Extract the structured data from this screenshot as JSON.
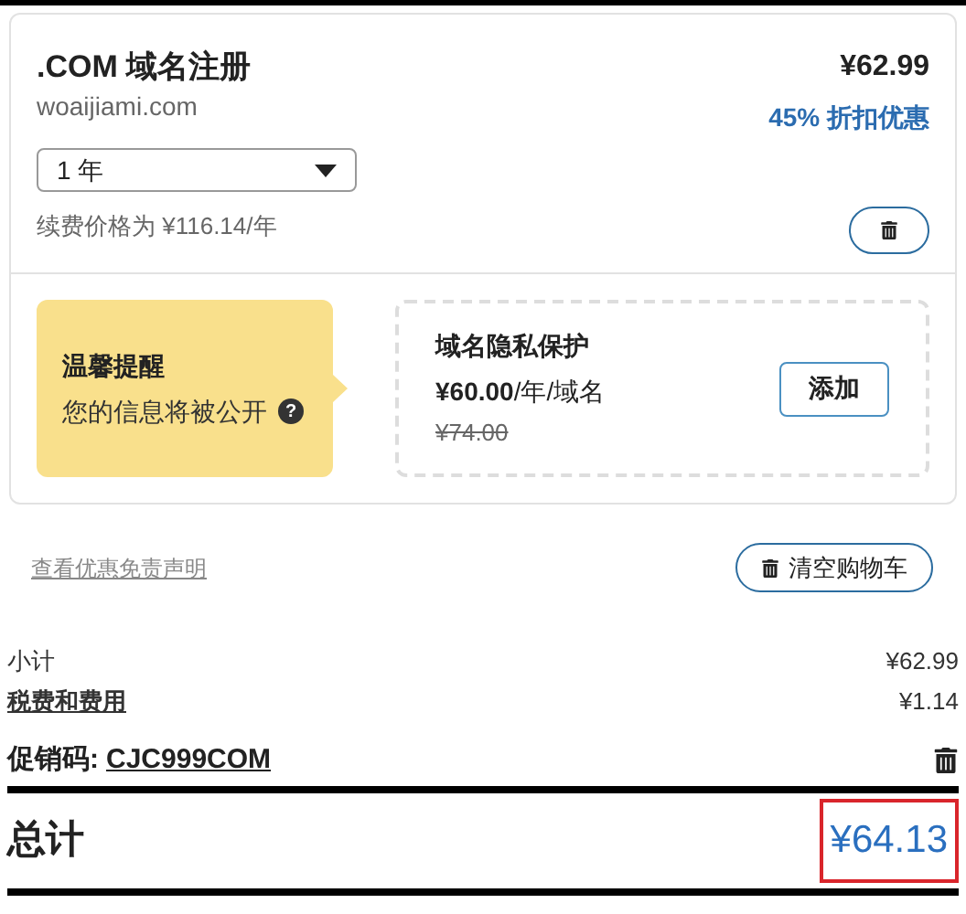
{
  "item": {
    "title": ".COM 域名注册",
    "domain": "woaijiami.com",
    "price": "¥62.99",
    "discount": "45% 折扣优惠",
    "term": "1 年",
    "renewal": "续费价格为 ¥116.14/年"
  },
  "notice": {
    "title": "温馨提醒",
    "text": "您的信息将被公开",
    "help": "?"
  },
  "privacy": {
    "title": "域名隐私保护",
    "price": "¥60.00",
    "unit": "/年/域名",
    "old_price": "¥74.00",
    "button": "添加"
  },
  "disclaimer_link": "查看优惠免责声明",
  "clear_cart": "清空购物车",
  "summary": [
    {
      "label": "小计",
      "value": "¥62.99",
      "kind": "plain"
    },
    {
      "label": "税费和费用",
      "value": "¥1.14",
      "kind": "link"
    }
  ],
  "promo": {
    "label": "促销码:",
    "code": "CJC999COM"
  },
  "total": {
    "label": "总计",
    "value": "¥64.13",
    "highlighted": true
  }
}
